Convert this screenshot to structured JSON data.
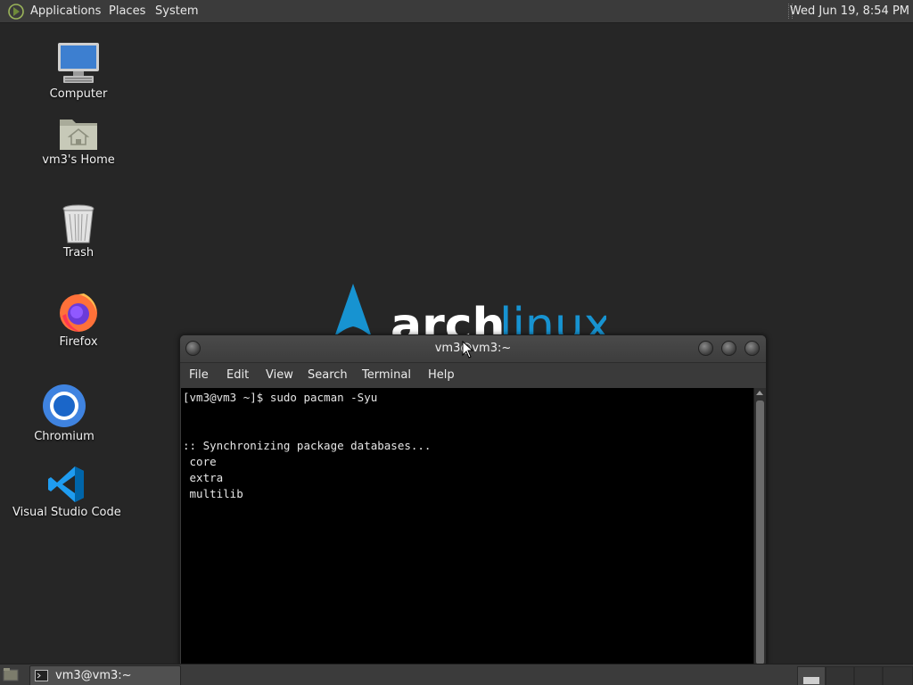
{
  "top_panel": {
    "menus": [
      "Applications",
      "Places",
      "System"
    ],
    "clock": "Wed Jun 19,  8:54 PM"
  },
  "desktop": {
    "icons": [
      {
        "label": "Computer",
        "icon": "computer-icon"
      },
      {
        "label": "vm3's Home",
        "icon": "home-folder-icon"
      },
      {
        "label": "Trash",
        "icon": "trash-icon"
      },
      {
        "label": "Firefox",
        "icon": "firefox-icon"
      },
      {
        "label": "Chromium",
        "icon": "chromium-icon"
      },
      {
        "label": "Visual Studio Code",
        "icon": "vscode-icon"
      }
    ],
    "wallpaper_logo": {
      "text_left": "arch",
      "text_right": "linux",
      "color": "#1793d1"
    }
  },
  "terminal": {
    "title": "vm3@vm3:~",
    "menu": [
      "File",
      "Edit",
      "View",
      "Search",
      "Terminal",
      "Help"
    ],
    "lines": [
      "[vm3@vm3 ~]$ sudo pacman -Syu",
      "",
      "",
      ":: Synchronizing package databases...",
      " core",
      " extra",
      " multilib"
    ]
  },
  "bottom_panel": {
    "task": "vm3@vm3:~",
    "workspaces": 4
  },
  "colors": {
    "panel": "#3b3b3b",
    "desktop": "#262626",
    "terminal_bg": "#000000",
    "arch_blue": "#1793d1"
  }
}
